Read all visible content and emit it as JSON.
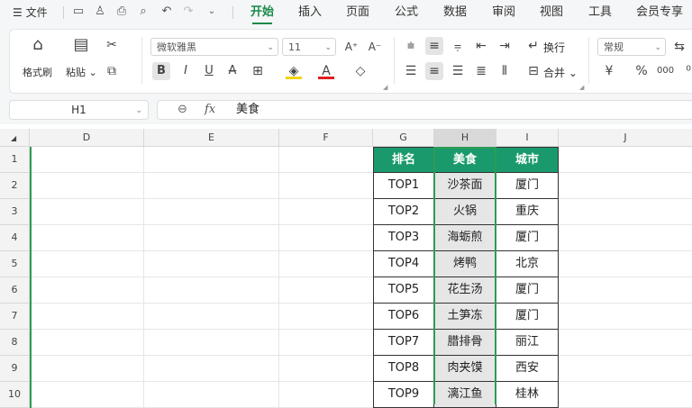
{
  "menu": {
    "file": "文件",
    "tabs": [
      "开始",
      "插入",
      "页面",
      "公式",
      "数据",
      "审阅",
      "视图",
      "工具",
      "会员专享"
    ]
  },
  "ribbon": {
    "format_painter": "格式刷",
    "paste": "粘贴",
    "font_name": "微软雅黑",
    "font_size": "11",
    "wrap_text": "换行",
    "merge": "合并",
    "number_format": "常规"
  },
  "formula_bar": {
    "cell_ref": "H1",
    "fx": "fx",
    "value": "美食"
  },
  "grid": {
    "columns": [
      "D",
      "E",
      "F",
      "G",
      "H",
      "I",
      "J"
    ],
    "rows": [
      "1",
      "2",
      "3",
      "4",
      "5",
      "6",
      "7",
      "8",
      "9",
      "10"
    ]
  },
  "table": {
    "headers": [
      "排名",
      "美食",
      "城市"
    ],
    "rows": [
      [
        "TOP1",
        "沙茶面",
        "厦门"
      ],
      [
        "TOP2",
        "火锅",
        "重庆"
      ],
      [
        "TOP3",
        "海蛎煎",
        "厦门"
      ],
      [
        "TOP4",
        "烤鸭",
        "北京"
      ],
      [
        "TOP5",
        "花生汤",
        "厦门"
      ],
      [
        "TOP6",
        "土笋冻",
        "厦门"
      ],
      [
        "TOP7",
        "腊排骨",
        "丽江"
      ],
      [
        "TOP8",
        "肉夹馍",
        "西安"
      ],
      [
        "TOP9",
        "漓江鱼",
        "桂林"
      ]
    ]
  },
  "colors": {
    "accent": "#1a8a4a",
    "header_fill": "#1a9a6c",
    "selection": "#2e9b53"
  }
}
